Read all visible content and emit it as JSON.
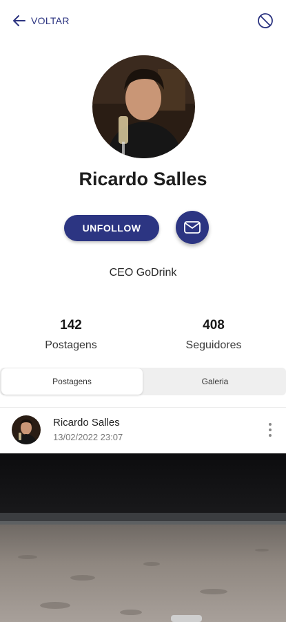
{
  "header": {
    "back_label": "VOLTAR",
    "back_icon": "arrow-left-icon",
    "block_icon": "block-icon",
    "accent_color": "#2c3582"
  },
  "profile": {
    "name": "Ricardo Salles",
    "bio": "CEO GoDrink",
    "unfollow_label": "UNFOLLOW",
    "message_icon": "mail-icon"
  },
  "stats": [
    {
      "value": "142",
      "label": "Postagens"
    },
    {
      "value": "408",
      "label": "Seguidores"
    }
  ],
  "tabs": [
    {
      "label": "Postagens",
      "active": true
    },
    {
      "label": "Galeria",
      "active": false
    }
  ],
  "post": {
    "author": "Ricardo Salles",
    "timestamp": "13/02/2022 23:07",
    "menu_icon": "more-vertical-icon"
  }
}
